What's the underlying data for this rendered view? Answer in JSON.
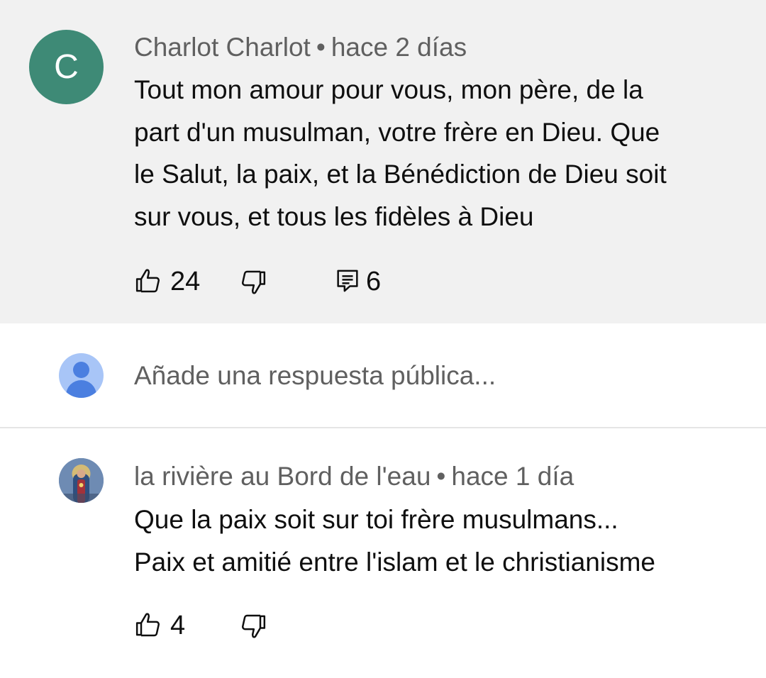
{
  "comment": {
    "avatar_letter": "C",
    "author": "Charlot Charlot",
    "separator": "•",
    "time": "hace 2 días",
    "text_lines": [
      "Tout mon amour pour vous, mon père, de la",
      "part d'un musulman, votre frère en Dieu. Que",
      "le Salut, la paix, et la Bénédiction de Dieu soit",
      "sur vous, et tous les fidèles à Dieu"
    ],
    "likes": "24",
    "replies_count": "6",
    "icons": [
      "thumb-up-icon",
      "thumb-down-icon",
      "comment-icon"
    ],
    "avatar_color": "#3e8a76"
  },
  "reply_box": {
    "placeholder": "Añade una respuesta pública..."
  },
  "reply": {
    "author": "la rivière au Bord de l'eau",
    "separator": "•",
    "time": "hace 1 día",
    "text_lines": [
      "Que la paix soit sur toi frère musulmans...",
      "Paix et amitié entre l'islam et le christianisme"
    ],
    "likes": "4",
    "icons": [
      "thumb-up-icon",
      "thumb-down-icon"
    ]
  },
  "colors": {
    "highlight_background": "#f1f1f1",
    "meta_text": "#606060",
    "body_text": "#0f0f0f"
  }
}
